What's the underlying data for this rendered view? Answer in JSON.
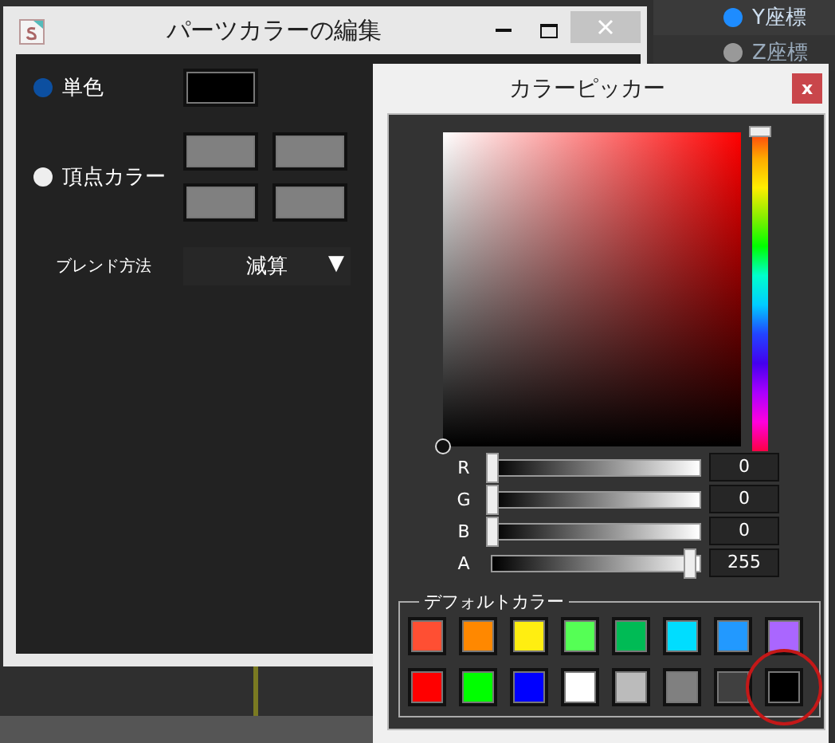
{
  "background_labels": [
    {
      "label": "Y座標",
      "selected": true
    },
    {
      "label": "Z座標",
      "selected": false
    }
  ],
  "part_color_window": {
    "title": "パーツカラーの編集",
    "modes": [
      {
        "label": "単色",
        "selected": true,
        "swatches": [
          {
            "color": "#000000"
          }
        ]
      },
      {
        "label": "頂点カラー",
        "selected": false,
        "swatches": [
          {
            "color": "#808080"
          },
          {
            "color": "#808080"
          },
          {
            "color": "#808080"
          },
          {
            "color": "#808080"
          }
        ]
      }
    ],
    "blend": {
      "label": "ブレンド方法",
      "value": "減算",
      "arrow": "▼"
    }
  },
  "color_picker": {
    "title": "カラーピッカー",
    "close": "x",
    "hue": {
      "level": 0
    },
    "channels": [
      {
        "name": "R",
        "level": 0,
        "value": "0"
      },
      {
        "name": "G",
        "level": 0,
        "value": "0"
      },
      {
        "name": "B",
        "level": 0,
        "value": "0"
      },
      {
        "name": "A",
        "level": 1,
        "value": "255"
      }
    ],
    "default_colors_label": "デフォルトカラー",
    "default_colors": [
      {
        "color": "#ff4f33",
        "selected": false
      },
      {
        "color": "#ff8800",
        "selected": false
      },
      {
        "color": "#ffee11",
        "selected": false
      },
      {
        "color": "#55ff55",
        "selected": false
      },
      {
        "color": "#00bb55",
        "selected": false
      },
      {
        "color": "#00ddff",
        "selected": false
      },
      {
        "color": "#2299ff",
        "selected": false
      },
      {
        "color": "#aa66ff",
        "selected": false
      },
      {
        "color": "#ff0000",
        "selected": false
      },
      {
        "color": "#00ff00",
        "selected": false
      },
      {
        "color": "#0000ff",
        "selected": false
      },
      {
        "color": "#ffffff",
        "selected": false
      },
      {
        "color": "#bbbbbb",
        "selected": false
      },
      {
        "color": "#808080",
        "selected": false
      },
      {
        "color": "#404040",
        "selected": false
      },
      {
        "color": "#000000",
        "selected": true
      }
    ]
  }
}
